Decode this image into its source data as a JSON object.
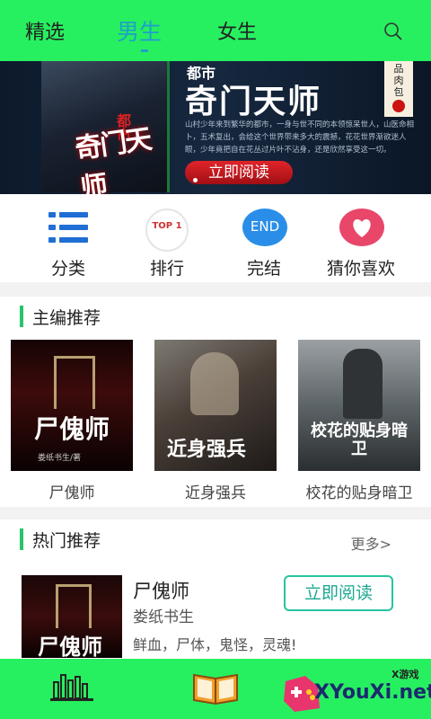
{
  "tabs": {
    "featured": "精选",
    "male": "男生",
    "female": "女生"
  },
  "banner": {
    "genre": "都市",
    "title": "奇门天师",
    "cover_title": "奇门天师",
    "cover_genre": "都市",
    "desc": "山村少年来到繁华的都市，一身与世不同的本领惊呆世人，山医命相卜，五术复出，会给这个世界带来多大的震撼，花花世界渐欲迷人眼，少年竟把自在花丛过片叶不沾身，还是欣然享受这一切。",
    "button": "立即阅读",
    "seal_text": "品肉包"
  },
  "quicknav": [
    {
      "label": "分类",
      "icon": "list-icon"
    },
    {
      "label": "排行",
      "icon": "top1-icon",
      "badge": "TOP 1"
    },
    {
      "label": "完结",
      "icon": "end-icon",
      "badge": "END"
    },
    {
      "label": "猜你喜欢",
      "icon": "heart-icon"
    }
  ],
  "editor_pick": {
    "title": "主编推荐",
    "books": [
      {
        "name": "尸傀师",
        "cover_text": "尸傀师",
        "cover_sub": "娄纸书生/著"
      },
      {
        "name": "近身强兵",
        "cover_text": "近身强兵",
        "cover_sub": ""
      },
      {
        "name": "校花的贴身暗卫",
        "cover_text": "校花的贴身暗卫",
        "cover_sub": ""
      }
    ]
  },
  "hot": {
    "title": "热门推荐",
    "more": "更多>",
    "book": {
      "name": "尸傀师",
      "author": "娄纸书生",
      "tags": "鲜血，尸体，鬼怪，灵魂!",
      "button": "立即阅读",
      "cover_text": "尸傀师"
    }
  },
  "watermark": {
    "brand": "XYouXi.net",
    "sub": "X游戏"
  },
  "colors": {
    "bar": "#27f060",
    "accent": "#1fa0c8",
    "section_bar": "#27c46a"
  }
}
